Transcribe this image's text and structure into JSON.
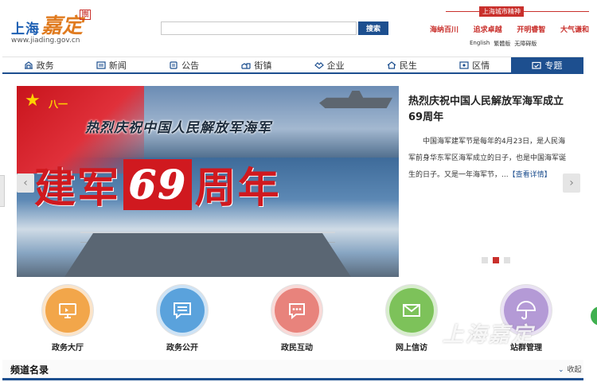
{
  "header": {
    "logo_text": "上海",
    "logo_art": "嘉定",
    "logo_seal": "團",
    "logo_url": "www.jiading.gov.cn",
    "search_placeholder": "",
    "search_button": "搜索",
    "spirit_tag": "上海城市精神",
    "spirit_words": [
      "海纳百川",
      "追求卓越",
      "开明睿智",
      "大气谦和"
    ],
    "lang_links": [
      "English",
      "繁體版",
      "无障碍版"
    ]
  },
  "nav": {
    "items": [
      {
        "label": "政务",
        "icon": "building-icon"
      },
      {
        "label": "新闻",
        "icon": "newspaper-icon"
      },
      {
        "label": "公告",
        "icon": "notice-icon"
      },
      {
        "label": "街镇",
        "icon": "town-icon"
      },
      {
        "label": "企业",
        "icon": "handshake-icon"
      },
      {
        "label": "民生",
        "icon": "home-icon"
      },
      {
        "label": "区情",
        "icon": "map-pin-icon"
      },
      {
        "label": "专题",
        "icon": "calendar-check-icon"
      }
    ],
    "active_index": 7
  },
  "slider": {
    "banner_subtitle": "热烈庆祝中国人民解放军海军",
    "banner_flag_text": "八一",
    "banner_big_before": "建军",
    "banner_big_number": "69",
    "banner_big_after": "周年",
    "article_title": "热烈庆祝中国人民解放军海军成立69周年",
    "article_desc": "中国海军建军节是每年的4月23日，是人民海军前身华东军区海军成立的日子，也是中国海军诞生的日子。又是一年海军节，...",
    "article_more": "【查看详情】",
    "prev_arrow": "‹",
    "next_arrow": "›",
    "dot_count": 3,
    "active_dot": 1
  },
  "quick_links": [
    {
      "label": "政务大厅",
      "color": "#f2a64a",
      "icon": "monitor-icon"
    },
    {
      "label": "政务公开",
      "color": "#5aa2dc",
      "icon": "chat-doc-icon"
    },
    {
      "label": "政民互动",
      "color": "#e8837c",
      "icon": "speech-bubble-icon"
    },
    {
      "label": "网上信访",
      "color": "#7dc25a",
      "icon": "envelope-icon"
    },
    {
      "label": "站群管理",
      "color": "#b49ad6",
      "icon": "umbrella-icon"
    }
  ],
  "watermark": "上海嘉定",
  "directory": {
    "title": "频道名录",
    "toggle_label": "收起",
    "toggle_icon": "chevron-down-icon"
  }
}
